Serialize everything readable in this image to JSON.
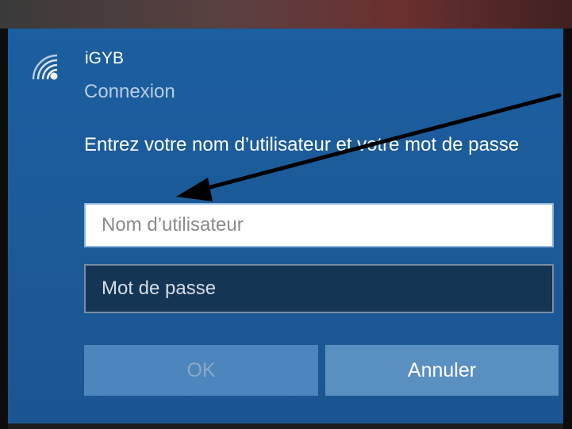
{
  "network": {
    "icon": "wifi-secured-icon",
    "ssid": "iGYB",
    "status": "Connexion"
  },
  "form": {
    "prompt": "Entrez votre nom d’utilisateur et votre mot de passe",
    "username_placeholder": "Nom d’utilisateur",
    "username_value": "",
    "password_placeholder": "Mot de passe",
    "password_value": ""
  },
  "buttons": {
    "ok_label": "OK",
    "ok_enabled": false,
    "cancel_label": "Annuler"
  },
  "annotation": {
    "icon": "arrow-icon",
    "color": "#000000"
  },
  "colors": {
    "panel": "#1b5a98",
    "input_dark": "#143554",
    "button": "#5a8fc2",
    "button_disabled": "#4d86bc"
  }
}
